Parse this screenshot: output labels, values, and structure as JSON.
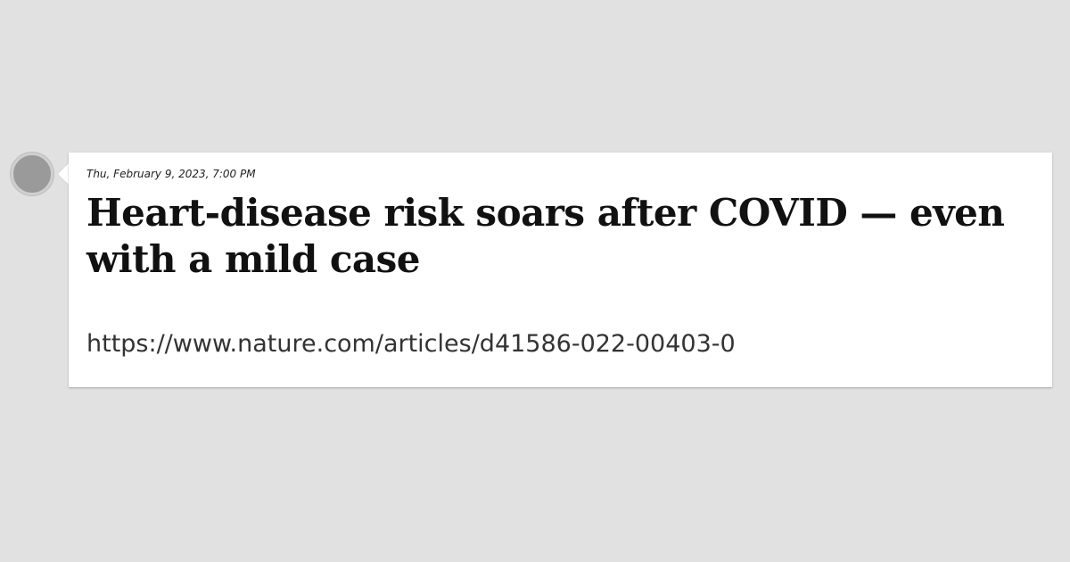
{
  "post": {
    "timestamp": "Thu, February 9, 2023, 7:00 PM",
    "headline": "Heart-disease risk soars after COVID — even with a mild case",
    "url": "https://www.nature.com/articles/d41586-022-00403-0"
  }
}
